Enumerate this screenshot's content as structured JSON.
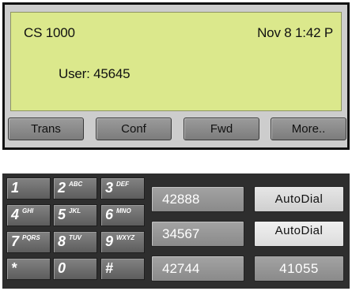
{
  "lcd": {
    "title": "CS 1000",
    "datetime": "Nov 8  1:42 P",
    "user_line": "User: 45645"
  },
  "softkeys": [
    "Trans",
    "Conf",
    "Fwd",
    "More.."
  ],
  "keypad": [
    {
      "digit": "1",
      "letters": ""
    },
    {
      "digit": "2",
      "letters": "ABC"
    },
    {
      "digit": "3",
      "letters": "DEF"
    },
    {
      "digit": "4",
      "letters": "GHI"
    },
    {
      "digit": "5",
      "letters": "JKL"
    },
    {
      "digit": "6",
      "letters": "MNO"
    },
    {
      "digit": "7",
      "letters": "PQRS"
    },
    {
      "digit": "8",
      "letters": "TUV"
    },
    {
      "digit": "9",
      "letters": "WXYZ"
    },
    {
      "digit": "*",
      "letters": ""
    },
    {
      "digit": "0",
      "letters": ""
    },
    {
      "digit": "#",
      "letters": ""
    }
  ],
  "memory_keys": [
    "42888",
    "34567",
    "42744"
  ],
  "right_keys": [
    "AutoDial",
    "AutoDial",
    "41055"
  ],
  "colors": {
    "lcd": "#dbe88c",
    "panel": "#2e2e2e"
  }
}
